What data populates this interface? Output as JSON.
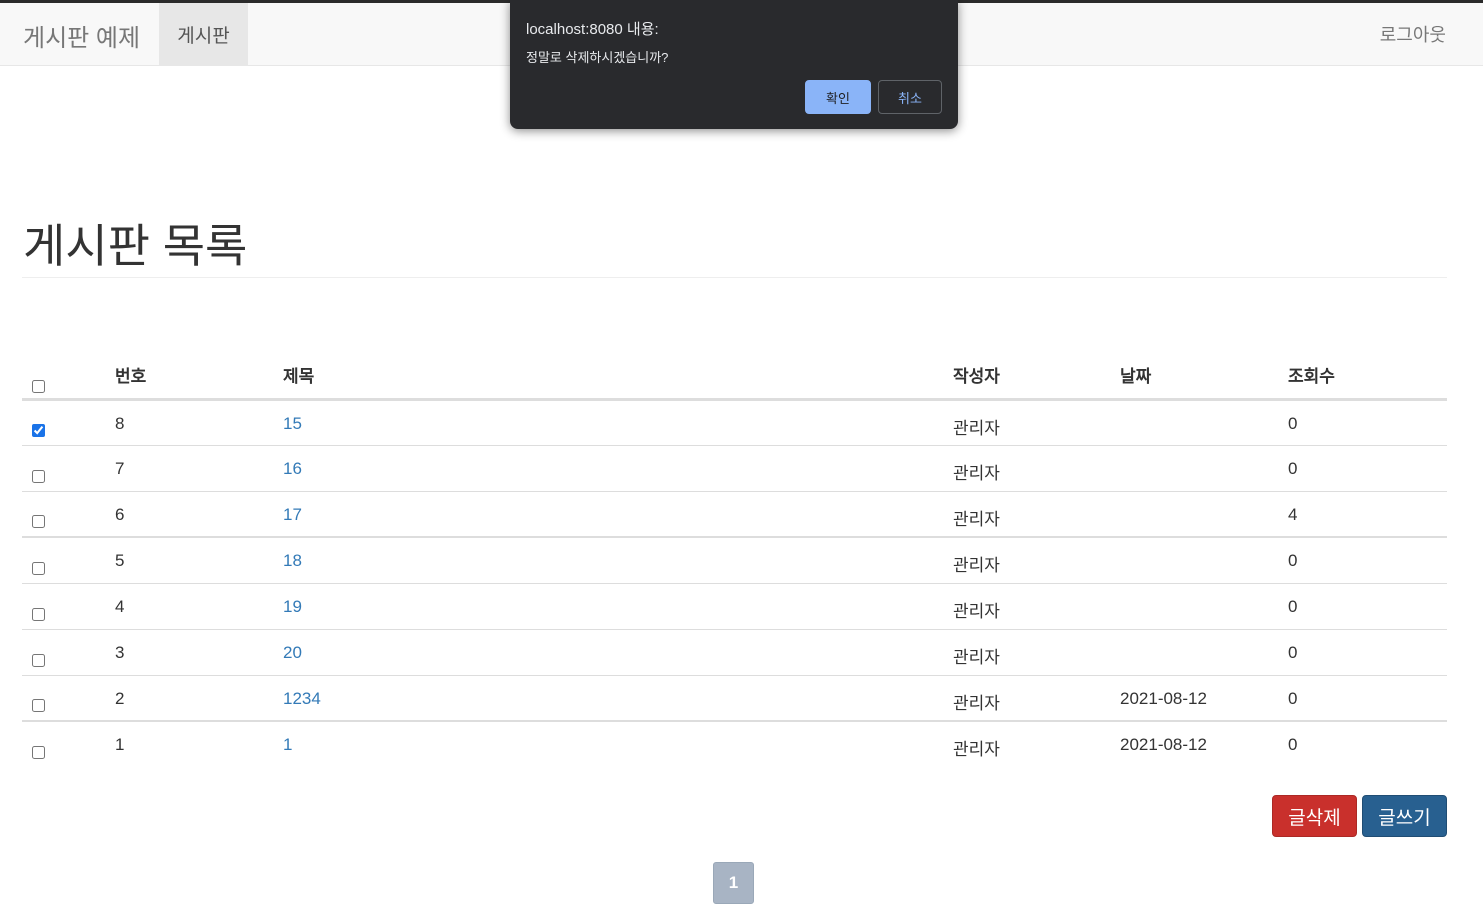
{
  "navbar": {
    "brand": "게시판 예제",
    "nav_item": "게시판",
    "logout": "로그아웃"
  },
  "page": {
    "title": "게시판 목록"
  },
  "table": {
    "headers": {
      "number": "번호",
      "title": "제목",
      "writer": "작성자",
      "date": "날짜",
      "views": "조회수"
    },
    "rows": [
      {
        "checked": true,
        "number": "8",
        "title": "15",
        "writer": "관리자",
        "date": "",
        "views": "0"
      },
      {
        "checked": false,
        "number": "7",
        "title": "16",
        "writer": "관리자",
        "date": "",
        "views": "0"
      },
      {
        "checked": false,
        "number": "6",
        "title": "17",
        "writer": "관리자",
        "date": "",
        "views": "4"
      },
      {
        "checked": false,
        "number": "5",
        "title": "18",
        "writer": "관리자",
        "date": "",
        "views": "0"
      },
      {
        "checked": false,
        "number": "4",
        "title": "19",
        "writer": "관리자",
        "date": "",
        "views": "0"
      },
      {
        "checked": false,
        "number": "3",
        "title": "20",
        "writer": "관리자",
        "date": "",
        "views": "0"
      },
      {
        "checked": false,
        "number": "2",
        "title": "1234",
        "writer": "관리자",
        "date": "2021-08-12",
        "views": "0"
      },
      {
        "checked": false,
        "number": "1",
        "title": "1",
        "writer": "관리자",
        "date": "2021-08-12",
        "views": "0"
      }
    ]
  },
  "actions": {
    "delete_label": "글삭제",
    "write_label": "글쓰기"
  },
  "pagination": {
    "current": "1"
  },
  "dialog": {
    "title": "localhost:8080 내용:",
    "message": "정말로 삭제하시겠습니까?",
    "ok_label": "확인",
    "cancel_label": "취소"
  },
  "colors": {
    "delete_button": "#c9302c",
    "write_button": "#286090",
    "link": "#337ab7",
    "dialog_bg": "#292a2d",
    "dialog_ok": "#8ab4f8"
  }
}
